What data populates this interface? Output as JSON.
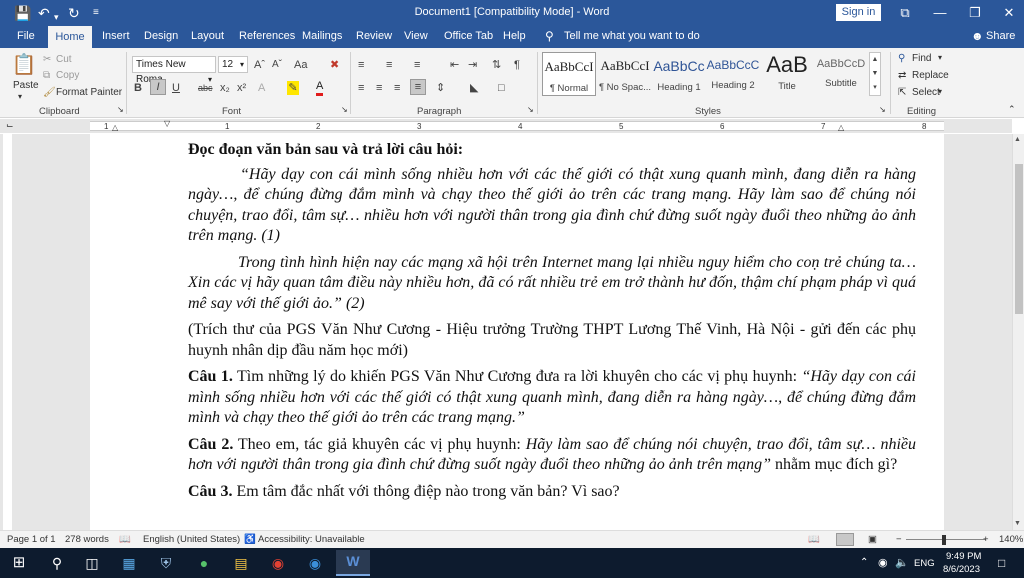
{
  "titlebar": {
    "title": "Document1 [Compatibility Mode]  -  Word",
    "signin": "Sign in",
    "minimize": "—",
    "restore": "❐",
    "close": "✕",
    "display_options": "⧉"
  },
  "tabs": [
    "File",
    "Home",
    "Insert",
    "Design",
    "Layout",
    "References",
    "Mailings",
    "Review",
    "View",
    "Office Tab",
    "Help"
  ],
  "tell_me": "Tell me what you want to do",
  "share": "Share",
  "ribbon": {
    "clipboard": {
      "paste": "Paste",
      "cut": "Cut",
      "copy": "Copy",
      "format_painter": "Format Painter",
      "label": "Clipboard"
    },
    "font": {
      "family": "Times New Roma",
      "size": "12",
      "label": "Font"
    },
    "paragraph": {
      "label": "Paragraph"
    },
    "styles": {
      "label": "Styles",
      "items": [
        {
          "sample": "AaBbCcI",
          "name": "¶ Normal"
        },
        {
          "sample": "AaBbCcI",
          "name": "¶ No Spac..."
        },
        {
          "sample": "AaBbCc",
          "name": "Heading 1"
        },
        {
          "sample": "AaBbCcC",
          "name": "Heading 2"
        },
        {
          "sample": "AaB",
          "name": "Title"
        },
        {
          "sample": "AaBbCcD",
          "name": "Subtitle"
        }
      ]
    },
    "editing": {
      "find": "Find",
      "replace": "Replace",
      "select": "Select",
      "label": "Editing"
    }
  },
  "ruler": {
    "numbers": [
      "1",
      "1",
      "2",
      "3",
      "4",
      "5",
      "6",
      "7",
      "8"
    ]
  },
  "document": {
    "heading": "Đọc đoạn văn bản sau và trả lời câu hỏi:",
    "para1": "“Hãy dạy con cái mình sống nhiều hơn với các thế giới có thật xung quanh mình, đang diễn ra hàng ngày…, để chúng đừng đắm mình và chạy theo thế giới ảo trên các trang mạng. Hãy làm sao để chúng nói chuyện, trao đổi, tâm sự… nhiều hơn với người thân trong gia đình chứ đừng suốt ngày đuổi theo những ảo ảnh trên mạng. (1)",
    "para2": "Trong tình hình hiện nay các mạng xã hội trên Internet mang lại nhiều nguy hiểm cho coṇ trẻ chúng ta… Xin các vị hãy quan tâm điều này nhiều hơn, đã có rất nhiều trẻ em trở thành hư đốn, thậm chí phạm pháp vì quá mê say với thế giới ảo.” (2)",
    "source": "(Trích thư của PGS Văn Như Cương - Hiệu trưởng Trường THPT Lương Thế Vinh, Hà Nội - gửi đến các phụ huynh nhân dịp đầu năm học mới)",
    "q1_label": "Câu 1.",
    "q1_text": " Tìm những lý do khiến PGS Văn Như Cương đưa ra lời khuyên cho các vị phụ huynh: ",
    "q1_quote": "“Hãy dạy con cái mình sống nhiều hơn với các thế giới có thật xung quanh mình, đang diễn ra hàng ngày…, để chúng đừng đắm mình và chạy theo thế giới ảo trên các trang mạng.”",
    "q2_label": "Câu 2.",
    "q2_text": " Theo em, tác giả khuyên các vị phụ huynh: ",
    "q2_quote": "Hãy làm sao để chúng nói chuyện, trao đổi, tâm sự… nhiều hơn với người thân trong gia đình chứ đừng suốt ngày đuổi theo những ảo ảnh trên mạng”",
    "q2_tail": " nhằm mục đích gì?",
    "q3_label": "Câu 3.",
    "q3_text": " Em tâm đắc nhất với thông điệp nào trong văn bản? Vì sao?"
  },
  "status": {
    "page": "Page 1 of 1",
    "words": "278 words",
    "language": "English (United States)",
    "accessibility": "Accessibility: Unavailable",
    "zoom": "140%"
  },
  "taskbar": {
    "language": "ENG",
    "time": "9:49 PM",
    "date": "8/6/2023"
  }
}
